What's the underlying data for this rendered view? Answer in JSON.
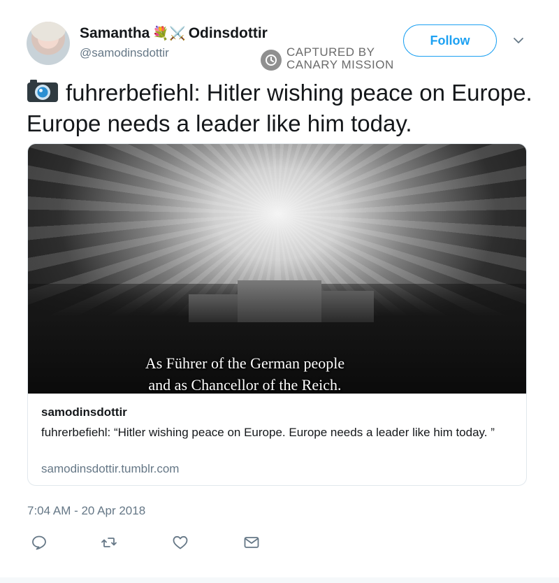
{
  "user": {
    "display_name_first": "Samantha",
    "display_name_emoji": "💐⚔️",
    "display_name_last": "Odinsdottir",
    "handle": "@samodinsdottir"
  },
  "follow_label": "Follow",
  "watermark": {
    "line1": "CAPTURED BY",
    "line2": "CANARY MISSION"
  },
  "tweet": {
    "icon": "camera-icon",
    "text": "fuhrerbefiehl: Hitler wishing peace on Europe. Europe needs a leader like him today."
  },
  "card": {
    "subtitle_line1": "As Führer of the German people",
    "subtitle_line2": "and as Chancellor of the Reich.",
    "title": "samodinsdottir",
    "description": "fuhrerbefiehl: “Hitler wishing peace on Europe. Europe needs a leader like him today. ”",
    "domain": "samodinsdottir.tumblr.com"
  },
  "timestamp": "7:04 AM - 20 Apr 2018",
  "actions": {
    "icons": [
      "reply-icon",
      "retweet-icon",
      "like-icon",
      "direct-message-icon"
    ]
  },
  "colors": {
    "accent": "#1da1f2",
    "text": "#14171a",
    "secondary_text": "#657786",
    "border": "#e1e8ed"
  }
}
